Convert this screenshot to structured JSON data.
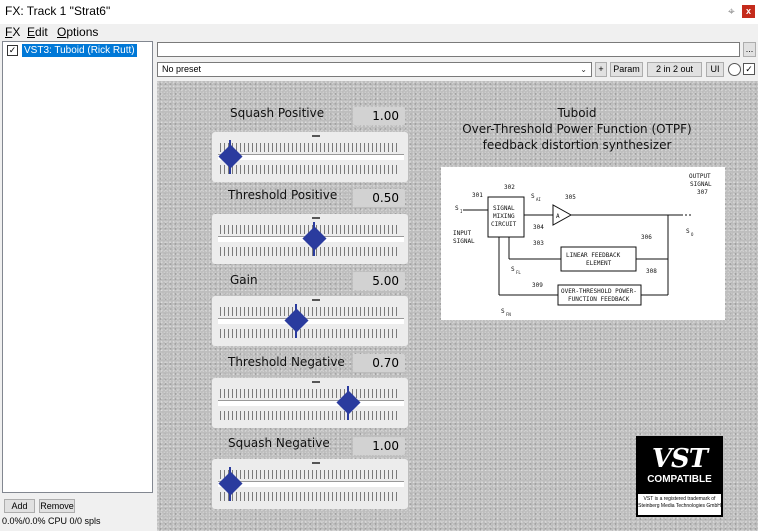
{
  "window": {
    "title": "FX: Track 1 \"Strat6\"",
    "pin_icon": "pin-icon",
    "close_label": "x"
  },
  "menu": {
    "items": [
      {
        "underline": "F",
        "rest": "X"
      },
      {
        "underline": "E",
        "rest": "dit"
      },
      {
        "underline": "O",
        "rest": "ptions"
      }
    ]
  },
  "fx_chain": {
    "items": [
      {
        "label": "VST3: Tuboid (Rick Rutt)",
        "checked": true
      }
    ]
  },
  "footer": {
    "add": "Add",
    "remove": "Remove",
    "cpu": "0.0%/0.0% CPU 0/0 spls"
  },
  "toolbar": {
    "dots": "...",
    "preset": "No preset",
    "plus": "+",
    "param": "Param",
    "io": "2 in 2 out",
    "ui": "UI"
  },
  "plugin": {
    "title_lines": [
      "Tuboid",
      "Over-Threshold Power Function (OTPF)",
      "feedback distortion synthesizer"
    ],
    "params": [
      {
        "name": "Squash Positive",
        "value": "1.00",
        "position": 0.0
      },
      {
        "name": "Threshold Positive",
        "value": "0.50",
        "position": 0.5
      },
      {
        "name": "Gain",
        "value": "5.00",
        "position": 0.39
      },
      {
        "name": "Threshold Negative",
        "value": "0.70",
        "position": 0.7
      },
      {
        "name": "Squash Negative",
        "value": "1.00",
        "position": 0.0
      }
    ],
    "diagram": {
      "labels": {
        "output": "OUTPUT",
        "signal_out": "SIGNAL",
        "n307": "307",
        "n301": "301",
        "n302": "302",
        "n305": "305",
        "n304": "304",
        "n303": "303",
        "n306": "306",
        "n308": "308",
        "n309": "309",
        "si": "S",
        "si_sub": "I",
        "sai": "S",
        "sai_sub": "AI",
        "input": "INPUT",
        "signal_in": "SIGNAL",
        "mix1": "SIGNAL",
        "mix2": "MIXING",
        "mix3": "CIRCUIT",
        "amp": "A",
        "so": "S",
        "so_sub": "O",
        "lin1": "LINEAR FEEDBACK",
        "lin2": "ELEMENT",
        "sfl": "S",
        "sfl_sub": "FL",
        "otpf1": "OVER-THRESHOLD POWER-",
        "otpf2": "FUNCTION FEEDBACK",
        "sfn": "S",
        "sfn_sub": "FN"
      }
    },
    "badge": {
      "logo": "VST",
      "compatible": "COMPATIBLE",
      "note": "VST is a registered trademark of Steinberg Media Technologies GmbH"
    }
  }
}
